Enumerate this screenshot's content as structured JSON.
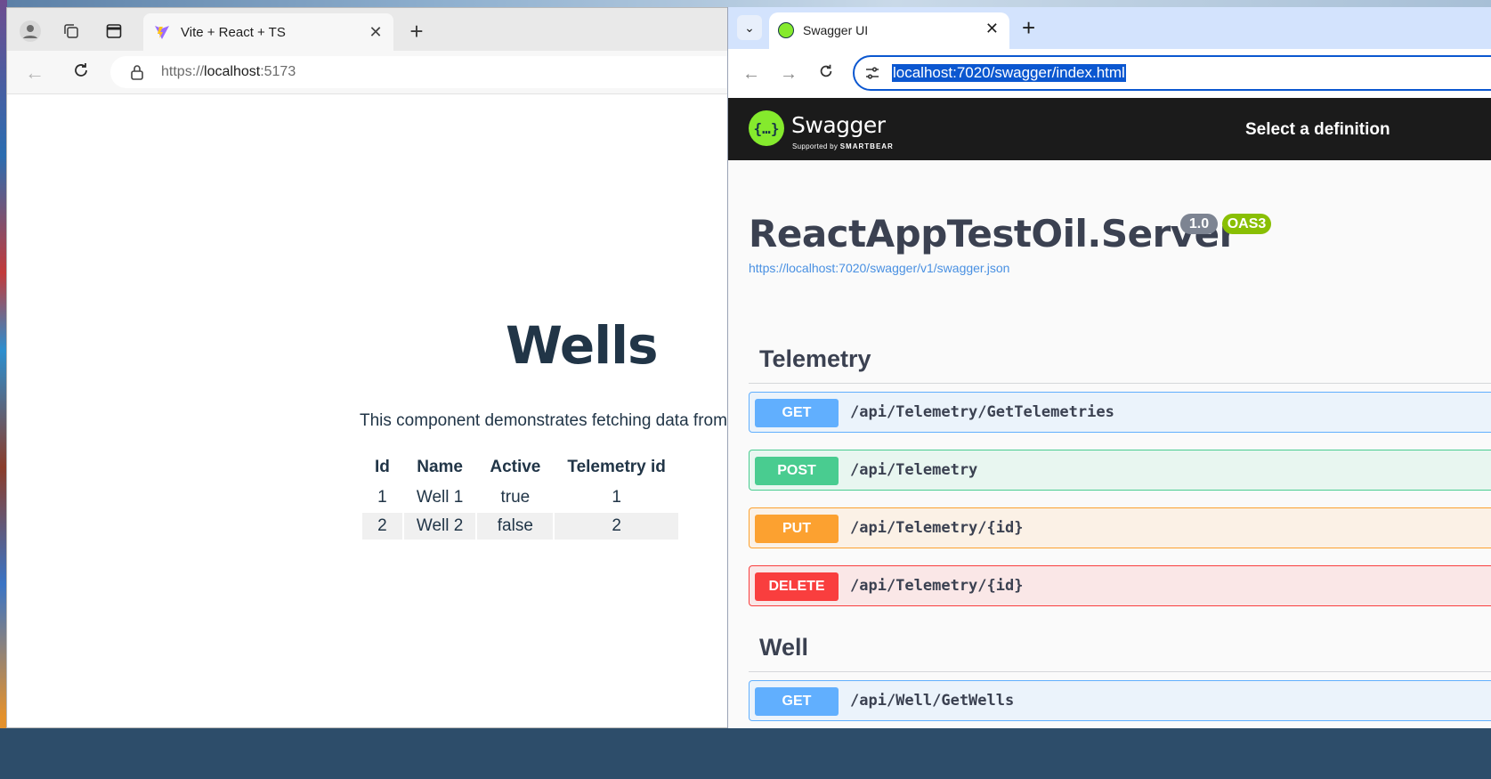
{
  "left_browser": {
    "tab": {
      "title": "Vite + React + TS"
    },
    "address": {
      "scheme": "https://",
      "host": "localhost",
      "port": ":5173"
    },
    "page": {
      "title": "Wells",
      "description": "This component demonstrates fetching data from",
      "table": {
        "headers": [
          "Id",
          "Name",
          "Active",
          "Telemetry id"
        ],
        "rows": [
          [
            "1",
            "Well 1",
            "true",
            "1"
          ],
          [
            "2",
            "Well 2",
            "false",
            "2"
          ]
        ]
      }
    }
  },
  "right_browser": {
    "tab": {
      "title": "Swagger UI"
    },
    "address": {
      "url": "localhost:7020/swagger/index.html"
    },
    "swagger": {
      "brand": "Swagger",
      "brand_sub_prefix": "Supported by ",
      "brand_sub_company": "SMARTBEAR",
      "select_definition_label": "Select a definition",
      "api_title": "ReactAppTestOil.Server",
      "version_badge": "1.0",
      "oas_badge": "OAS3",
      "spec_link": "https://localhost:7020/swagger/v1/swagger.json",
      "tags": [
        {
          "name": "Telemetry",
          "operations": [
            {
              "method": "GET",
              "path": "/api/Telemetry/GetTelemetries"
            },
            {
              "method": "POST",
              "path": "/api/Telemetry"
            },
            {
              "method": "PUT",
              "path": "/api/Telemetry/{id}"
            },
            {
              "method": "DELETE",
              "path": "/api/Telemetry/{id}"
            }
          ]
        },
        {
          "name": "Well",
          "operations": [
            {
              "method": "GET",
              "path": "/api/Well/GetWells"
            }
          ]
        }
      ]
    }
  },
  "colors": {
    "get": "#61affe",
    "post": "#49cc90",
    "put": "#fca130",
    "delete": "#f93e3e",
    "swagger_green": "#85ea2d",
    "heading": "#213547"
  },
  "icons": [
    "profile-icon",
    "workspaces-icon",
    "vertical-tabs-icon",
    "vite-icon",
    "close-icon",
    "new-tab-icon",
    "back-icon",
    "refresh-icon",
    "lock-icon",
    "tab-search-icon",
    "swagger-icon",
    "forward-icon",
    "site-settings-icon",
    "swagger-logo-icon"
  ]
}
